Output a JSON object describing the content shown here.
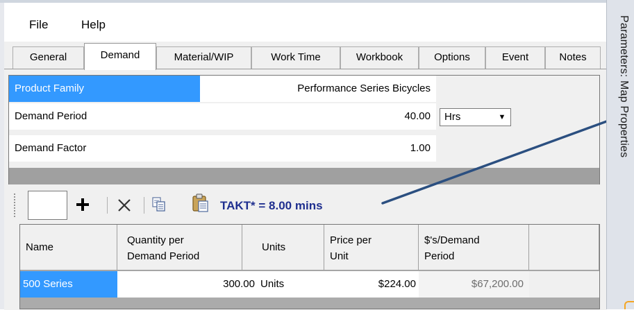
{
  "menu": {
    "file": "File",
    "help": "Help"
  },
  "tabs": [
    {
      "label": "General"
    },
    {
      "label": "Demand"
    },
    {
      "label": "Material/WIP"
    },
    {
      "label": "Work Time"
    },
    {
      "label": "Workbook"
    },
    {
      "label": "Options"
    },
    {
      "label": "Event"
    },
    {
      "label": "Notes"
    }
  ],
  "demand_grid": {
    "product_family_label": "Product Family",
    "product_family_value": "Performance Series Bicycles",
    "demand_period_label": "Demand Period",
    "demand_period_value": "40.00",
    "demand_period_unit": "Hrs",
    "demand_factor_label": "Demand Factor",
    "demand_factor_value": "1.00"
  },
  "toolbar": {
    "add_icon": "plus-icon",
    "delete_icon": "x-icon",
    "copy_icon": "copy-icon",
    "paste_icon": "paste-icon",
    "takt_text": "TAKT* = 8.00 mins"
  },
  "product_table": {
    "headers": {
      "name": "Name",
      "qty_line1": "Quantity per",
      "qty_line2": "Demand Period",
      "units": "Units",
      "price_line1": "Price per",
      "price_line2": "Unit",
      "sd_line1": "$'s/Demand",
      "sd_line2": "Period"
    },
    "rows": [
      {
        "name": "500 Series",
        "quantity": "300.00",
        "units": "Units",
        "price": "$224.00",
        "demand_value": "$67,200.00"
      }
    ]
  },
  "sidebar": {
    "title": "Parameters: Map Properties"
  },
  "colors": {
    "selection": "#3399ff",
    "takt_text": "#1f2f8f",
    "arrow": "#2b4f80"
  }
}
